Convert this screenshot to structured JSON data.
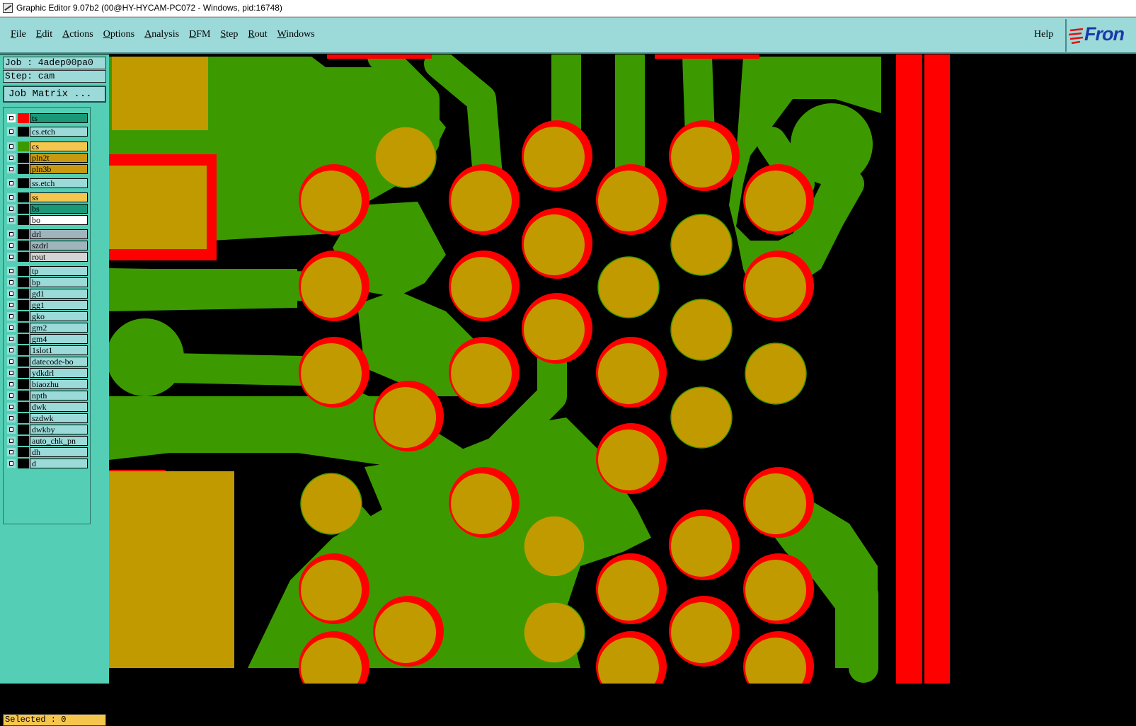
{
  "window": {
    "title": "Graphic Editor 9.07b2 (00@HY-HYCAM-PC072 - Windows, pid:16748)"
  },
  "menu": {
    "items": [
      "File",
      "Edit",
      "Actions",
      "Options",
      "Analysis",
      "DFM",
      "Step",
      "Rout",
      "Windows"
    ],
    "help": "Help"
  },
  "logo": {
    "text": "Fron"
  },
  "sidebar": {
    "job": "Job : 4adep00pa0",
    "step": "Step: cam",
    "job_matrix": "Job Matrix ...",
    "status": "Selected : 0",
    "layers": [
      {
        "name": "ts",
        "color": "#1a9878",
        "swatch": "#ff0000",
        "active": true
      },
      {
        "name": "cs.etch",
        "color": "#9cd9d9"
      },
      {
        "name": "cs",
        "color": "#f5c64d",
        "swatch": "#3c9a00"
      },
      {
        "name": "pln2t",
        "color": "#c99a10"
      },
      {
        "name": "pln3b",
        "color": "#c99a10"
      },
      {
        "name": "ss.etch",
        "color": "#9cd9d9"
      },
      {
        "name": "ss",
        "color": "#f5c64d"
      },
      {
        "name": "bs",
        "color": "#1a9878"
      },
      {
        "name": "bo",
        "color": "#ffffff"
      },
      {
        "name": "drl",
        "color": "#a0b4bc"
      },
      {
        "name": "szdrl",
        "color": "#a0b4bc"
      },
      {
        "name": "rout",
        "color": "#d4d4d4"
      },
      {
        "name": "tp",
        "color": "#9cd9d9"
      },
      {
        "name": "bp",
        "color": "#9cd9d9"
      },
      {
        "name": "gd1",
        "color": "#9cd9d9"
      },
      {
        "name": "gg1",
        "color": "#9cd9d9"
      },
      {
        "name": "gko",
        "color": "#9cd9d9"
      },
      {
        "name": "gm2",
        "color": "#9cd9d9"
      },
      {
        "name": "gm4",
        "color": "#9cd9d9"
      },
      {
        "name": "1slot1",
        "color": "#9cd9d9"
      },
      {
        "name": "datecode-bo",
        "color": "#9cd9d9"
      },
      {
        "name": "ydkdrl",
        "color": "#9cd9d9"
      },
      {
        "name": "biaozhu",
        "color": "#9cd9d9"
      },
      {
        "name": "npth",
        "color": "#9cd9d9"
      },
      {
        "name": "dwk",
        "color": "#9cd9d9"
      },
      {
        "name": "szdwk",
        "color": "#9cd9d9"
      },
      {
        "name": "dwkby",
        "color": "#9cd9d9"
      },
      {
        "name": "auto_chk_pn",
        "color": "#9cd9d9"
      },
      {
        "name": "dh",
        "color": "#9cd9d9"
      },
      {
        "name": "d",
        "color": "#9cd9d9"
      }
    ]
  },
  "colors": {
    "copper": "#3c9a00",
    "pad": "#c19a00",
    "mask": "#ff0000",
    "background": "#000000",
    "menubar": "#9cd9d9",
    "sidebar": "#54cfb5"
  }
}
